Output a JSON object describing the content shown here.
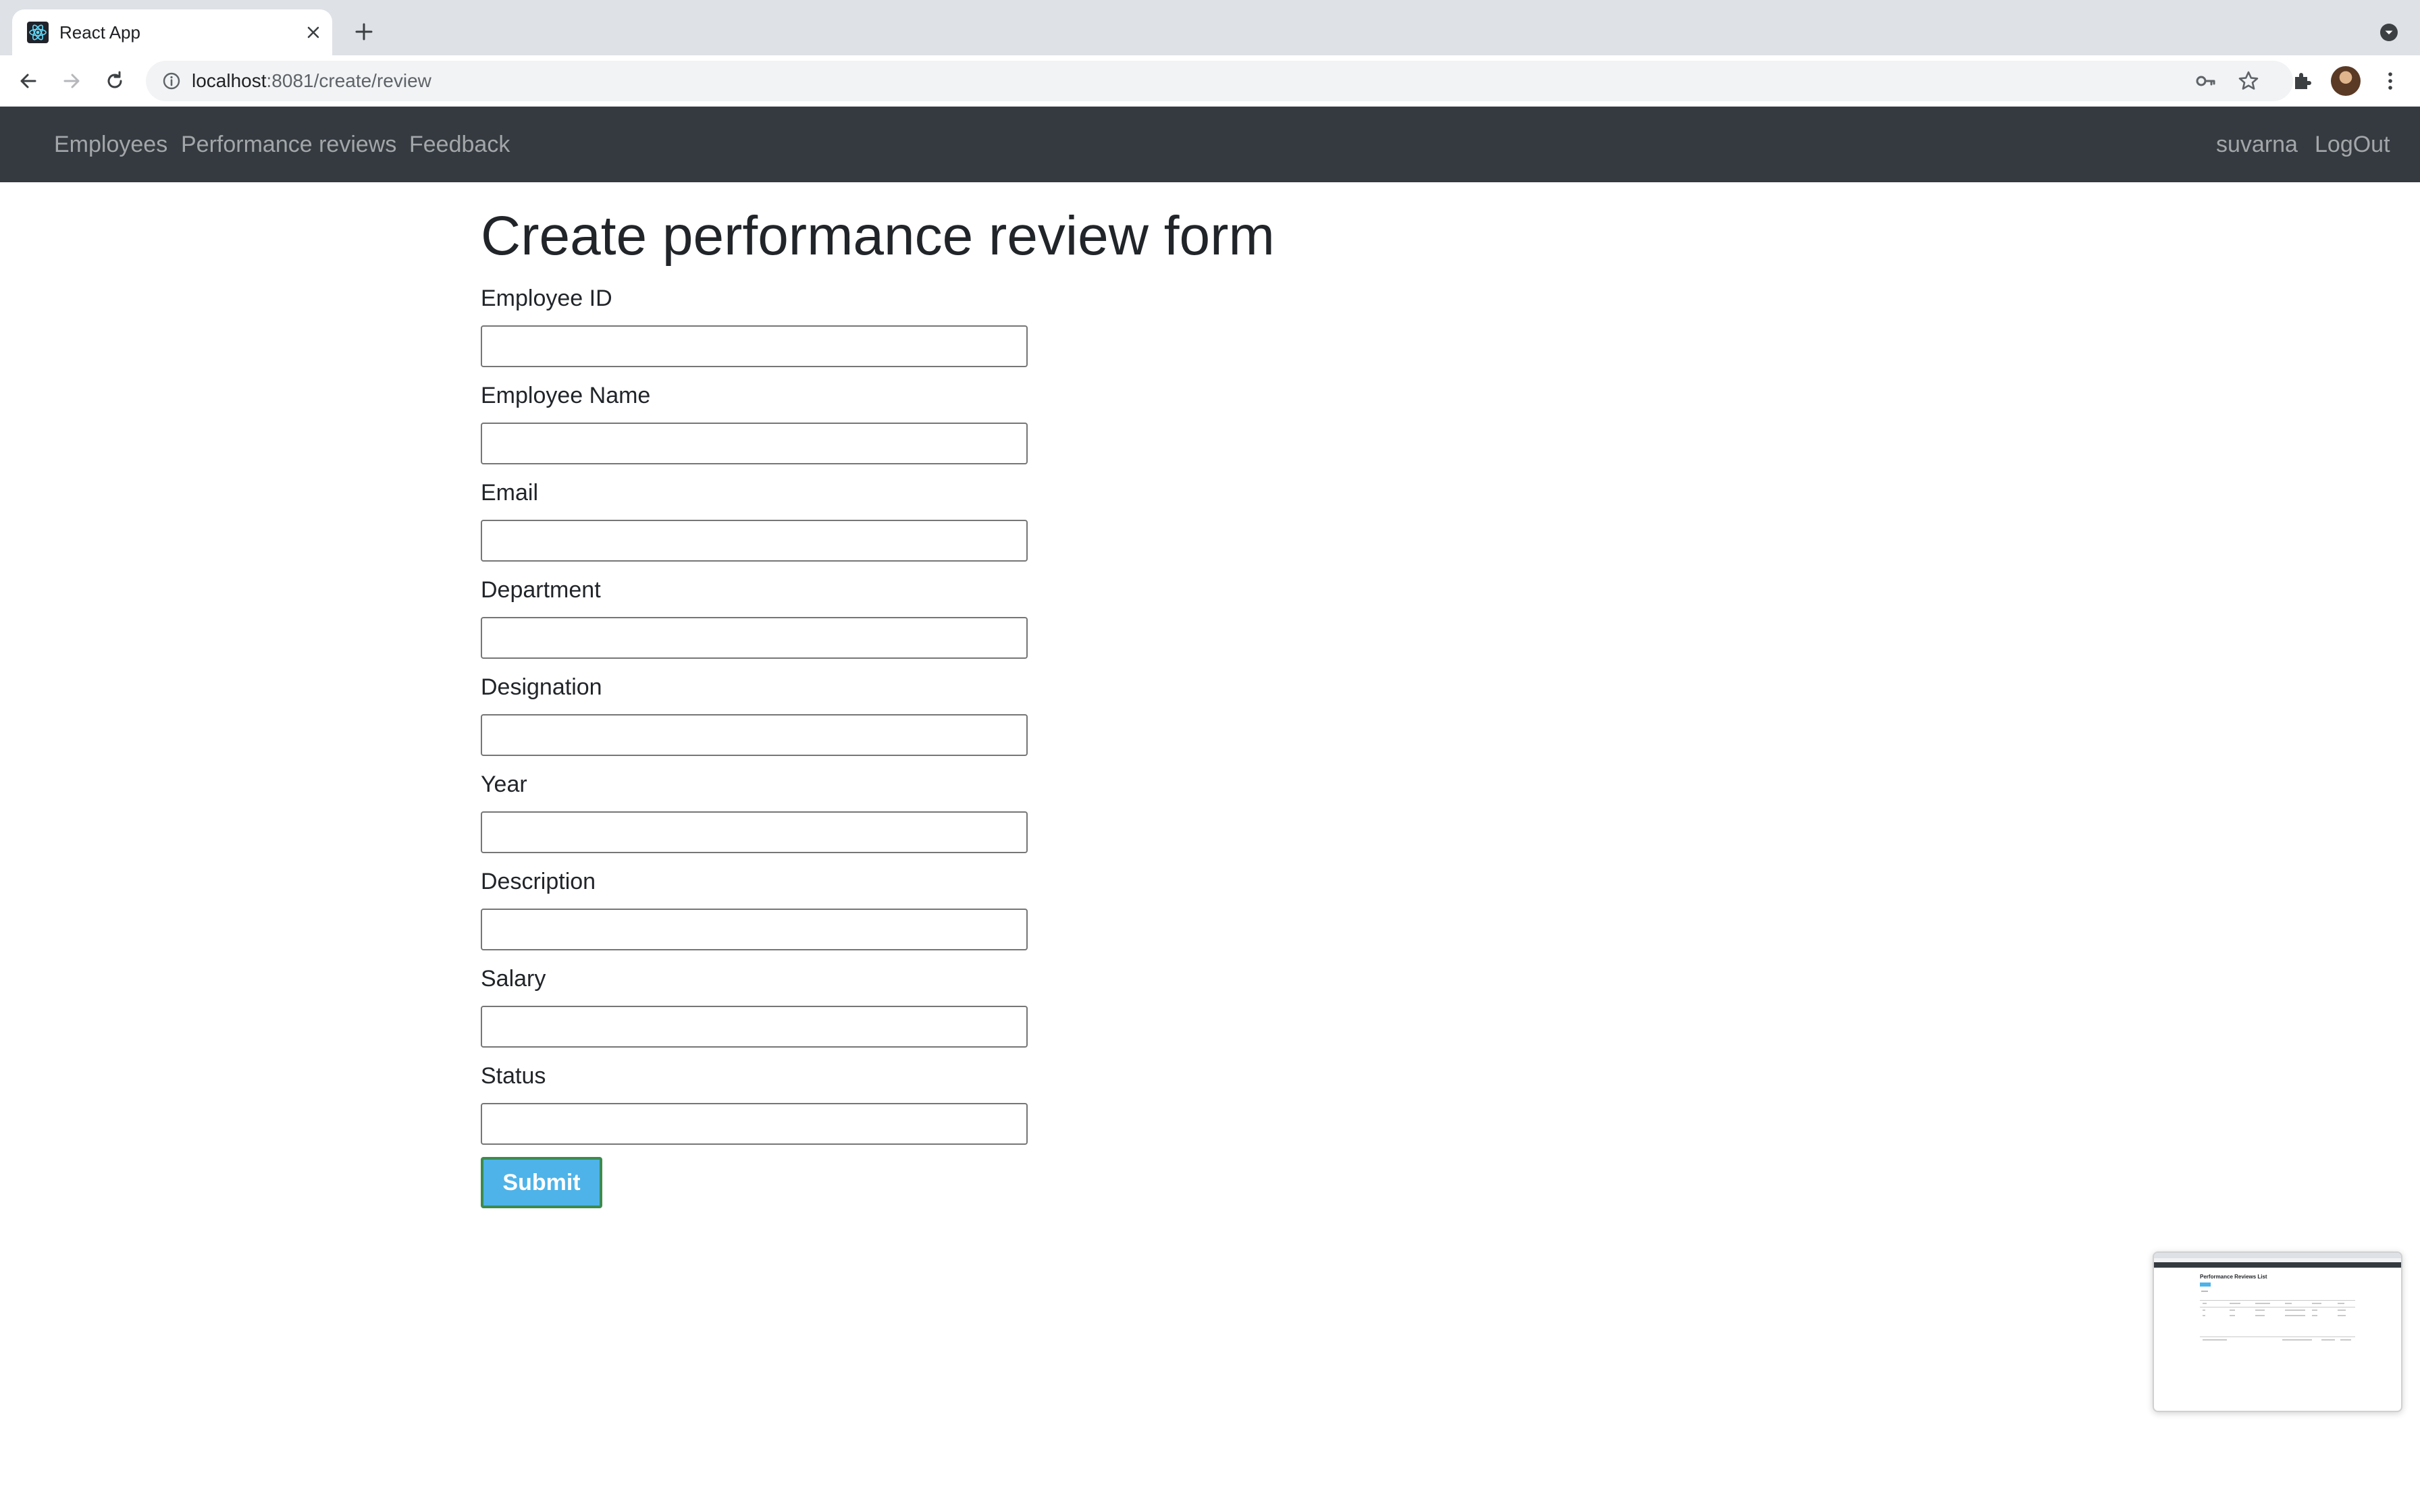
{
  "browser": {
    "tab_title": "React App",
    "url_host": "localhost",
    "url_rest": ":8081/create/review"
  },
  "navbar": {
    "links": [
      "Employees",
      "Performance reviews",
      "Feedback"
    ],
    "user": "suvarna",
    "logout": "LogOut"
  },
  "form": {
    "title": "Create performance review form",
    "fields": [
      {
        "label": "Employee ID",
        "value": ""
      },
      {
        "label": "Employee Name",
        "value": ""
      },
      {
        "label": "Email",
        "value": ""
      },
      {
        "label": "Department",
        "value": ""
      },
      {
        "label": "Designation",
        "value": ""
      },
      {
        "label": "Year",
        "value": ""
      },
      {
        "label": "Description",
        "value": ""
      },
      {
        "label": "Salary",
        "value": ""
      },
      {
        "label": "Status",
        "value": ""
      }
    ],
    "submit_label": "Submit"
  },
  "thumbnail": {
    "title": "Performance Reviews List"
  },
  "colors": {
    "navbar_bg": "#343a40",
    "submit_bg": "#4eb3e8",
    "submit_border": "#3c8b4e"
  }
}
